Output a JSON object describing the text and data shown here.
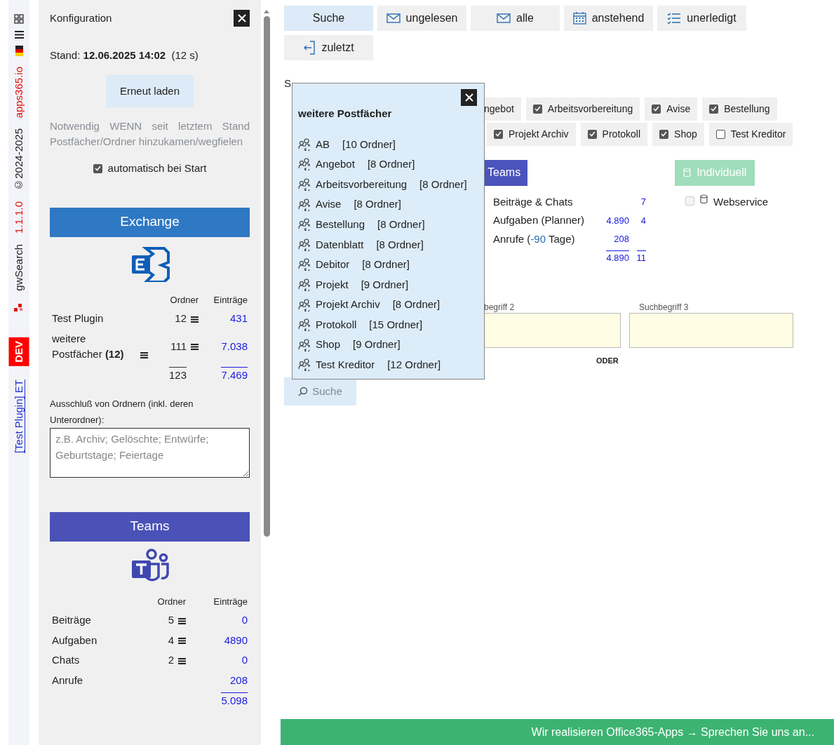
{
  "side_strip": {
    "items": [
      {
        "kind": "grid"
      },
      {
        "kind": "menu"
      },
      {
        "kind": "flag"
      },
      {
        "kind": "text",
        "text": "apps365.io",
        "color": "#e01010"
      },
      {
        "kind": "text",
        "text": "©2024-2025",
        "color": "#222222"
      },
      {
        "kind": "text",
        "text": "1.1.1.0",
        "color": "#e01010"
      },
      {
        "kind": "text",
        "text": "gwSearch",
        "color": "#222222"
      },
      {
        "kind": "logo"
      },
      {
        "kind": "badge",
        "text": "DEV"
      },
      {
        "kind": "link",
        "text": "[Test Plugin] ET"
      }
    ]
  },
  "config": {
    "title": "Konfiguration",
    "stand": {
      "label": "Stand:",
      "value": "12.06.2025 14:02",
      "age": "(12 s)"
    },
    "reload_button": "Erneut laden",
    "hint": "Notwendig WENN seit letztem Stand Postfächer/Ordner hinzukamen/wegfielen",
    "auto_start": {
      "label": "automatisch bei Start",
      "checked": true
    },
    "exchange": {
      "title": "Exchange",
      "columns": [
        "Ordner",
        "Einträge"
      ],
      "rows": [
        {
          "label": "Test Plugin",
          "folders": "12",
          "entries": "431",
          "menu": false
        },
        {
          "label": "weitere Postfächer **(12)**",
          "folders": "111",
          "entries": "7.038",
          "menu": true
        }
      ],
      "totals": {
        "folders": "123",
        "entries": "7.469"
      }
    },
    "exclusion": {
      "label": "Ausschluß von Ordnern (inkl. deren Unterordner):",
      "placeholder": "z.B. Archiv; Gelöschte; Entwürfe; Geburtstage; Feiertage"
    },
    "teams": {
      "title": "Teams",
      "columns": [
        "Ordner",
        "Einträge"
      ],
      "rows": [
        {
          "label": "Beiträge",
          "folders": "5",
          "entries": "0"
        },
        {
          "label": "Aufgaben",
          "folders": "4",
          "entries": "4890"
        },
        {
          "label": "Chats",
          "folders": "2",
          "entries": "0"
        },
        {
          "label": "Anrufe",
          "entries": "208"
        }
      ],
      "totals": {
        "entries": "5.098"
      }
    }
  },
  "toolbar": {
    "tabs": [
      {
        "label": "Suche",
        "kind": "plain",
        "selected": true
      },
      {
        "label": "ungelesen",
        "kind": "mail",
        "selected": false
      },
      {
        "label": "alle",
        "kind": "mail",
        "selected": false
      },
      {
        "label": "anstehend",
        "kind": "calendar",
        "selected": false
      },
      {
        "label": "unerledigt",
        "kind": "list",
        "selected": false
      },
      {
        "label": "zuletzt",
        "kind": "recent",
        "selected": false
      }
    ]
  },
  "main": {
    "heading": "S",
    "mailbox_chips": [
      {
        "items": [
          {
            "label": "ngebot"
          },
          {
            "label": "Arbeitsvorbereitung",
            "checked": true
          },
          {
            "label": "Avise",
            "checked": true
          },
          {
            "label": "Bestellung",
            "checked": true
          }
        ]
      },
      {
        "items": [
          {
            "label": "Projekt Archiv",
            "checked": true
          },
          {
            "label": "Protokoll",
            "checked": true
          },
          {
            "label": "Shop",
            "checked": true
          },
          {
            "label": "Test Kreditor",
            "checked": false
          }
        ]
      }
    ],
    "teams_button": "Teams",
    "custom_button": {
      "label": "Individuell",
      "disabled": true
    },
    "teams_stats": {
      "rows": [
        {
          "label": [
            "Beiträge & Chats"
          ],
          "value_2": "7"
        },
        {
          "label": [
            "Aufgaben (Planner)"
          ],
          "value_1": "4.890",
          "value_2": "4"
        },
        {
          "label": [
            "Anrufe (",
            "-90",
            " Tage)"
          ],
          "value_1": "208"
        }
      ],
      "totals": [
        "4.890",
        "11"
      ]
    },
    "webservice": {
      "label": "Webservice",
      "checked": false,
      "disabled": true
    },
    "search_fields": [
      {
        "label": "begriff 2"
      },
      {
        "label": "Suchbegriff 3"
      }
    ],
    "connector": "ODER",
    "search_button": {
      "label": "Suche",
      "disabled": true
    }
  },
  "popup": {
    "title": "weitere Postfächer",
    "items": [
      {
        "name": "AB",
        "count": "[10 Ordner]"
      },
      {
        "name": "Angebot",
        "count": "[8 Ordner]"
      },
      {
        "name": "Arbeitsvorbereitung",
        "count": "[8 Ordner]"
      },
      {
        "name": "Avise",
        "count": "[8 Ordner]"
      },
      {
        "name": "Bestellung",
        "count": "[8 Ordner]"
      },
      {
        "name": "Datenblatt",
        "count": "[8 Ordner]"
      },
      {
        "name": "Debitor",
        "count": "[8 Ordner]"
      },
      {
        "name": "Projekt",
        "count": "[9 Ordner]"
      },
      {
        "name": "Projekt Archiv",
        "count": "[8 Ordner]"
      },
      {
        "name": "Protokoll",
        "count": "[15 Ordner]"
      },
      {
        "name": "Shop",
        "count": "[9 Ordner]"
      },
      {
        "name": "Test Kreditor",
        "count": "[12 Ordner]"
      }
    ]
  },
  "banner": "Wir realisieren Office365-Apps → Sprechen Sie uns an..."
}
